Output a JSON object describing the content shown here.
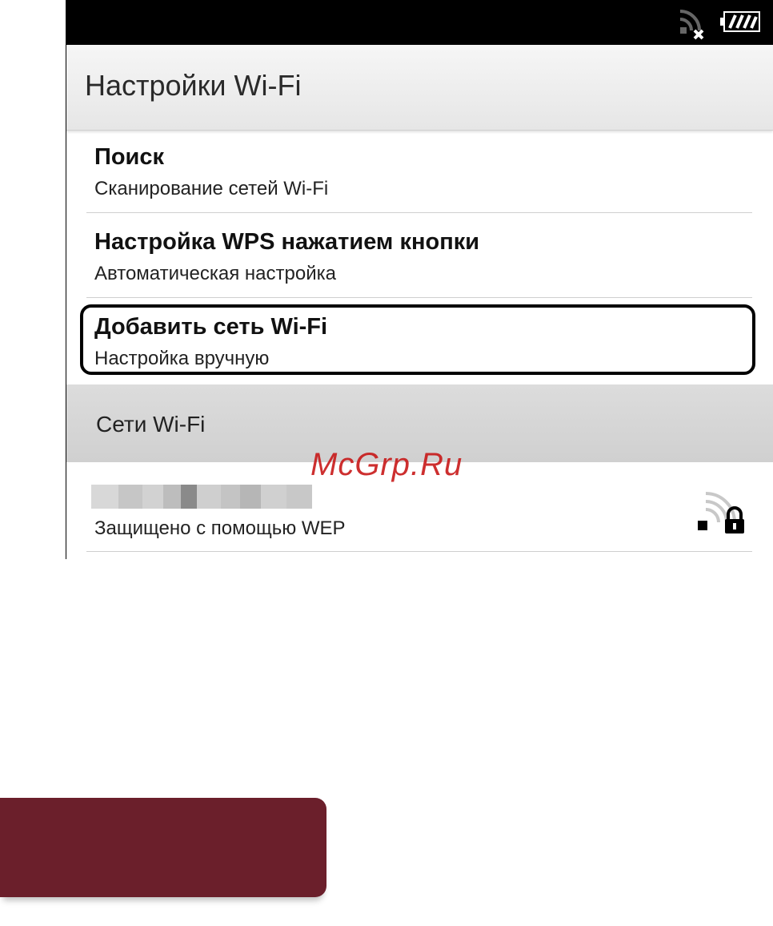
{
  "status_bar": {
    "icons": [
      "wifi-off-icon",
      "battery-icon"
    ]
  },
  "header": {
    "title": "Настройки Wi-Fi"
  },
  "menu": {
    "items": [
      {
        "title": "Поиск",
        "subtitle": "Сканирование сетей Wi-Fi"
      },
      {
        "title": "Настройка WPS нажатием кнопки",
        "subtitle": "Автоматическая настройка"
      },
      {
        "title": "Добавить сеть Wi-Fi",
        "subtitle": "Настройка вручную"
      }
    ]
  },
  "networks_section": {
    "label": "Сети Wi-Fi",
    "networks": [
      {
        "security": "Защищено с помощью WEP",
        "icon": "wifi-lock-icon"
      }
    ]
  },
  "watermark": "McGrp.Ru",
  "colors": {
    "highlight_border": "#000000",
    "watermark": "#c81919",
    "banner": "#6b1f2b"
  }
}
